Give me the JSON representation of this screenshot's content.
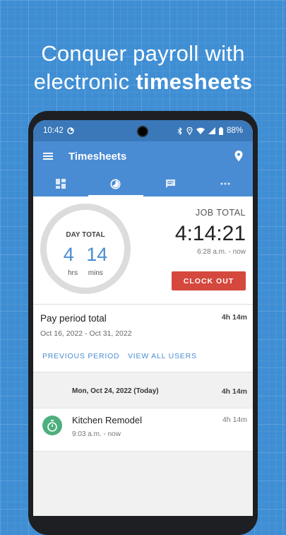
{
  "headline": {
    "line1": "Conquer payroll with",
    "line2_prefix": "electronic ",
    "line2_bold": "timesheets"
  },
  "status_bar": {
    "time": "10:42",
    "battery": "88%"
  },
  "app_bar": {
    "title": "Timesheets"
  },
  "tabs": [
    {
      "icon": "dashboard-icon",
      "active": false
    },
    {
      "icon": "timer-icon",
      "active": true
    },
    {
      "icon": "chat-icon",
      "active": false
    },
    {
      "icon": "more-icon",
      "active": false
    }
  ],
  "day_total": {
    "label": "DAY TOTAL",
    "hours": "4",
    "minutes": "14",
    "hours_unit": "hrs",
    "minutes_unit": "mins"
  },
  "job_total": {
    "label": "JOB TOTAL",
    "time": "4:14:21",
    "since": "6:28 a.m. - now",
    "clock_out_label": "CLOCK OUT"
  },
  "pay_period": {
    "title": "Pay period total",
    "total": "4h 14m",
    "range": "Oct 16, 2022 - Oct 31, 2022",
    "previous_label": "PREVIOUS PERIOD",
    "view_all_label": "VIEW ALL USERS"
  },
  "day_group": {
    "date": "Mon, Oct 24, 2022 (Today)",
    "total": "4h 14m"
  },
  "entries": [
    {
      "name": "Kitchen Remodel",
      "time": "9:03 a.m. - now",
      "duration": "4h 14m",
      "icon": "stopwatch-icon"
    }
  ],
  "colors": {
    "primary": "#4a8cd3",
    "accent": "#d5483d",
    "entry_icon": "#4caf7d",
    "background": "#3f8ed4"
  }
}
